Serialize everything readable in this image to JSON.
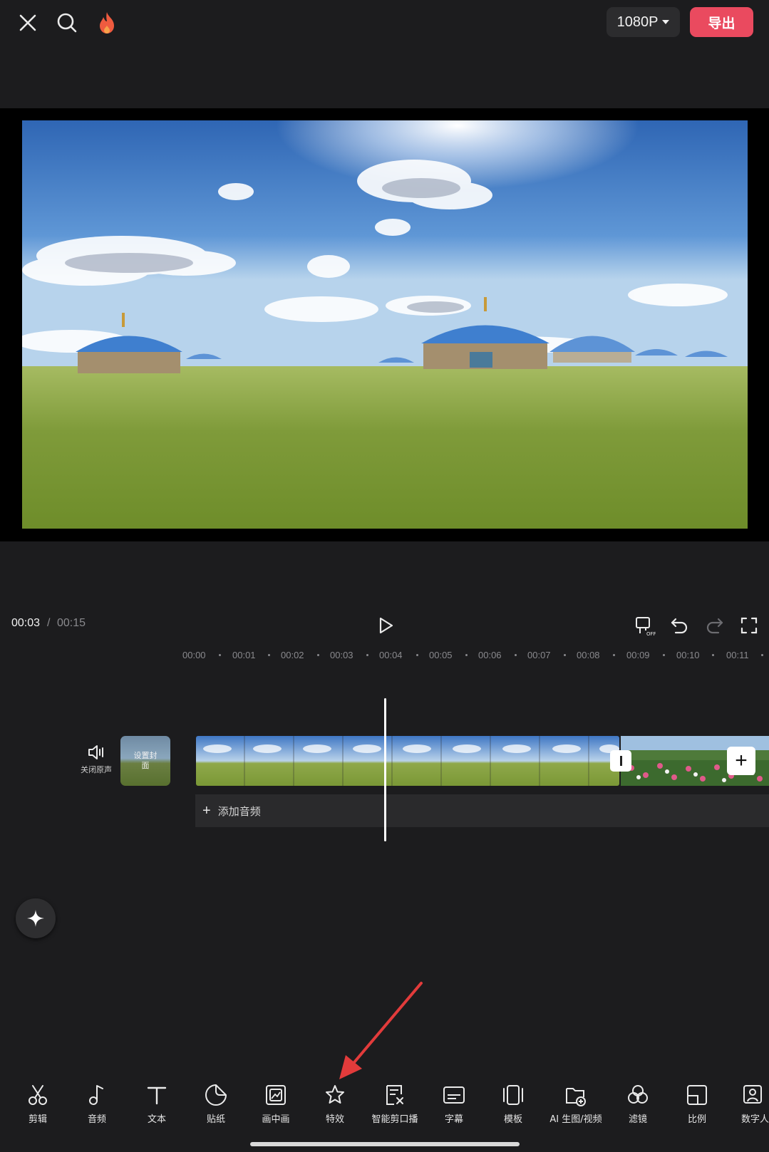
{
  "header": {
    "resolution_label": "1080P",
    "export_label": "导出"
  },
  "playback": {
    "current_time": "00:03",
    "separator": "/",
    "total_time": "00:15"
  },
  "ruler": {
    "ticks": [
      "00:00",
      "00:01",
      "00:02",
      "00:03",
      "00:04",
      "00:05",
      "00:06",
      "00:07",
      "00:08",
      "00:09",
      "00:10",
      "00:11"
    ]
  },
  "tracks": {
    "mute_label": "关闭原声",
    "cover_label": "设置封面",
    "add_audio_label": "添加音频"
  },
  "toolbar": {
    "items": [
      {
        "label": "剪辑",
        "icon": "scissors-icon"
      },
      {
        "label": "音频",
        "icon": "music-note-icon"
      },
      {
        "label": "文本",
        "icon": "text-icon"
      },
      {
        "label": "贴纸",
        "icon": "sticker-icon"
      },
      {
        "label": "画中画",
        "icon": "picture-in-picture-icon"
      },
      {
        "label": "特效",
        "icon": "star-effect-icon"
      },
      {
        "label": "智能剪口播",
        "icon": "smart-edit-icon"
      },
      {
        "label": "字幕",
        "icon": "subtitle-icon"
      },
      {
        "label": "模板",
        "icon": "template-icon"
      },
      {
        "label": "AI 生图/视频",
        "icon": "ai-generate-icon"
      },
      {
        "label": "滤镜",
        "icon": "filter-icon"
      },
      {
        "label": "比例",
        "icon": "ratio-icon"
      },
      {
        "label": "数字人",
        "icon": "digital-human-icon"
      }
    ]
  },
  "colors": {
    "background": "#1c1c1e",
    "export_accent": "#ea4a5f",
    "arrow": "#e23b3b"
  }
}
